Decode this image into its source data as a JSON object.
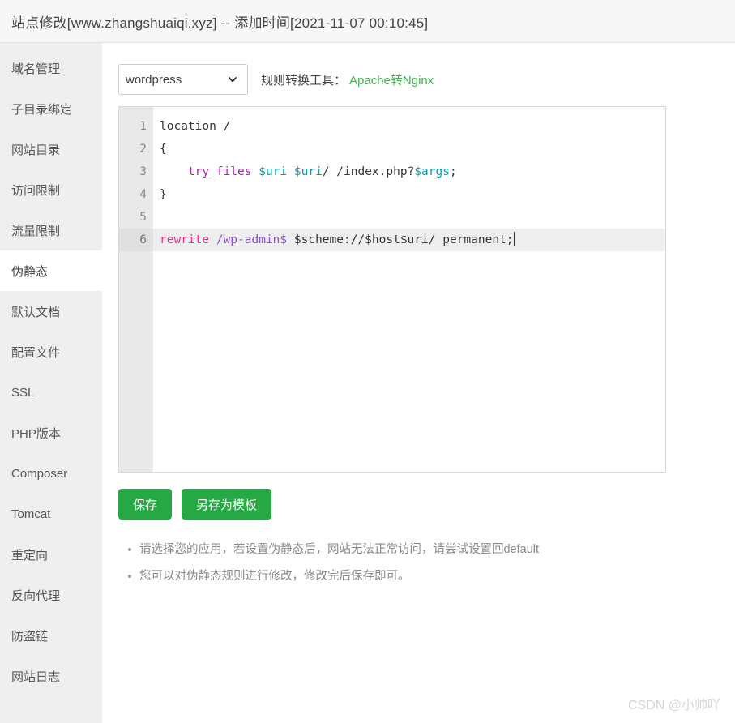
{
  "header": {
    "title": "站点修改[www.zhangshuaiqi.xyz] -- 添加时间[2021-11-07 00:10:45]"
  },
  "sidebar": {
    "items": [
      {
        "label": "域名管理",
        "active": false
      },
      {
        "label": "子目录绑定",
        "active": false
      },
      {
        "label": "网站目录",
        "active": false
      },
      {
        "label": "访问限制",
        "active": false
      },
      {
        "label": "流量限制",
        "active": false
      },
      {
        "label": "伪静态",
        "active": true
      },
      {
        "label": "默认文档",
        "active": false
      },
      {
        "label": "配置文件",
        "active": false
      },
      {
        "label": "SSL",
        "active": false
      },
      {
        "label": "PHP版本",
        "active": false
      },
      {
        "label": "Composer",
        "active": false
      },
      {
        "label": "Tomcat",
        "active": false
      },
      {
        "label": "重定向",
        "active": false
      },
      {
        "label": "反向代理",
        "active": false
      },
      {
        "label": "防盗链",
        "active": false
      },
      {
        "label": "网站日志",
        "active": false
      }
    ]
  },
  "toolbar": {
    "select_value": "wordpress",
    "select_options": [
      "wordpress"
    ],
    "converter_label": "规则转换工具：",
    "converter_link": "Apache转Nginx",
    "chevron_icon": "chevron-down-icon"
  },
  "editor": {
    "line_numbers": [
      "1",
      "2",
      "3",
      "4",
      "5",
      "6"
    ],
    "active_line": 6,
    "lines": [
      {
        "number": "1",
        "tokens": [
          {
            "t": "location /",
            "c": "txt"
          }
        ]
      },
      {
        "number": "2",
        "tokens": [
          {
            "t": "{",
            "c": "txt"
          }
        ]
      },
      {
        "number": "3",
        "tokens": [
          {
            "t": "    ",
            "c": "txt"
          },
          {
            "t": "try_files",
            "c": "fn"
          },
          {
            "t": " ",
            "c": "txt"
          },
          {
            "t": "$uri",
            "c": "var"
          },
          {
            "t": " ",
            "c": "txt"
          },
          {
            "t": "$uri",
            "c": "var"
          },
          {
            "t": "/ /index.php?",
            "c": "txt"
          },
          {
            "t": "$args",
            "c": "var"
          },
          {
            "t": ";",
            "c": "txt"
          }
        ]
      },
      {
        "number": "4",
        "tokens": [
          {
            "t": "}",
            "c": "txt"
          }
        ]
      },
      {
        "number": "5",
        "tokens": [
          {
            "t": "",
            "c": "txt"
          }
        ]
      },
      {
        "number": "6",
        "tokens": [
          {
            "t": "rewrite",
            "c": "kw"
          },
          {
            "t": " ",
            "c": "txt"
          },
          {
            "t": "/wp-admin$",
            "c": "path"
          },
          {
            "t": " $scheme://$host$uri/ permanent;",
            "c": "txt"
          }
        ]
      }
    ],
    "plain_text": "location /\n{\n    try_files $uri $uri/ /index.php?$args;\n}\n\nrewrite /wp-admin$ $scheme://$host$uri/ permanent;"
  },
  "buttons": {
    "save": "保存",
    "save_as_template": "另存为模板"
  },
  "hints": [
    "请选择您的应用，若设置伪静态后，网站无法正常访问，请尝试设置回default",
    "您可以对伪静态规则进行修改，修改完后保存即可。"
  ],
  "watermark": "CSDN @小帅吖",
  "colors": {
    "accent_green": "#26a844",
    "link_green": "#3fb24d",
    "sidebar_bg": "#efefef",
    "header_bg": "#f7f7f7"
  }
}
